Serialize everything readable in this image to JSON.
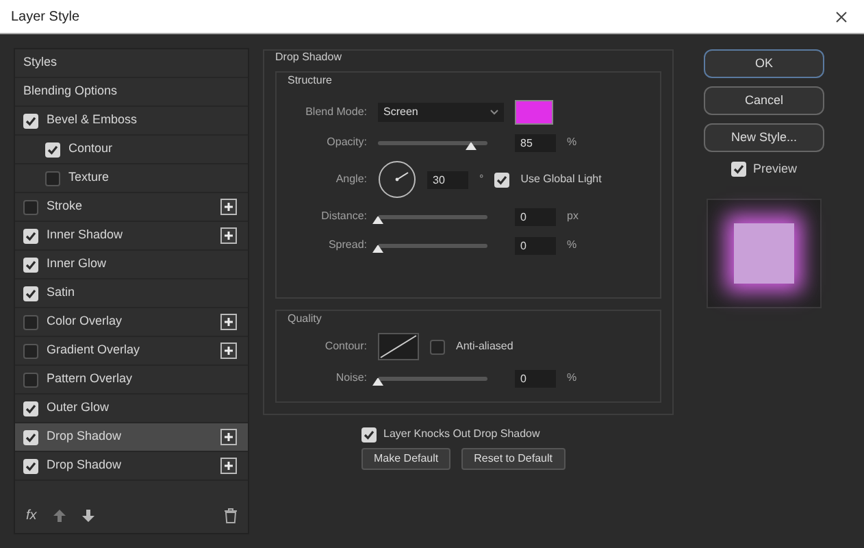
{
  "window": {
    "title": "Layer Style"
  },
  "sidebar": {
    "items": [
      {
        "label": "Styles",
        "kind": "plain",
        "selected": false
      },
      {
        "label": "Blending Options",
        "kind": "plain",
        "selected": false
      },
      {
        "label": "Bevel & Emboss",
        "kind": "check",
        "checked": true,
        "selected": false,
        "add": false,
        "children": [
          {
            "label": "Contour",
            "kind": "check",
            "checked": true,
            "selected": false,
            "add": false
          },
          {
            "label": "Texture",
            "kind": "check",
            "checked": false,
            "selected": false,
            "add": false
          }
        ]
      },
      {
        "label": "Stroke",
        "kind": "check",
        "checked": false,
        "selected": false,
        "add": true
      },
      {
        "label": "Inner Shadow",
        "kind": "check",
        "checked": true,
        "selected": false,
        "add": true
      },
      {
        "label": "Inner Glow",
        "kind": "check",
        "checked": true,
        "selected": false,
        "add": false
      },
      {
        "label": "Satin",
        "kind": "check",
        "checked": true,
        "selected": false,
        "add": false
      },
      {
        "label": "Color Overlay",
        "kind": "check",
        "checked": false,
        "selected": false,
        "add": true
      },
      {
        "label": "Gradient Overlay",
        "kind": "check",
        "checked": false,
        "selected": false,
        "add": true
      },
      {
        "label": "Pattern Overlay",
        "kind": "check",
        "checked": false,
        "selected": false,
        "add": false
      },
      {
        "label": "Outer Glow",
        "kind": "check",
        "checked": true,
        "selected": false,
        "add": false
      },
      {
        "label": "Drop Shadow",
        "kind": "check",
        "checked": true,
        "selected": true,
        "add": true
      },
      {
        "label": "Drop Shadow",
        "kind": "check",
        "checked": true,
        "selected": false,
        "add": true
      }
    ],
    "fx": "fx"
  },
  "panel": {
    "title": "Drop Shadow",
    "structure": {
      "title": "Structure",
      "blend_mode_label": "Blend Mode:",
      "blend_mode": "Screen",
      "color": "#e030e8",
      "opacity": {
        "label": "Opacity:",
        "level": 0.85,
        "value": "85",
        "unit": "%"
      },
      "angle": {
        "label": "Angle:",
        "value": "30",
        "unit": "°",
        "global_light": {
          "label": "Use Global Light",
          "checked": true
        }
      },
      "distance": {
        "label": "Distance:",
        "level": 0,
        "value": "0",
        "unit": "px"
      },
      "spread": {
        "label": "Spread:",
        "level": 0,
        "value": "0",
        "unit": "%"
      }
    },
    "quality": {
      "title": "Quality",
      "contour_label": "Contour:",
      "anti_aliased": {
        "label": "Anti-aliased",
        "checked": false
      },
      "noise": {
        "label": "Noise:",
        "level": 0,
        "value": "0",
        "unit": "%"
      }
    },
    "knockout": {
      "label": "Layer Knocks Out Drop Shadow",
      "checked": true
    },
    "buttons": [
      "Make Default",
      "Reset to Default"
    ]
  },
  "actions": {
    "buttons": [
      {
        "label": "OK",
        "selected": true
      },
      {
        "label": "Cancel",
        "selected": false
      },
      {
        "label": "New Style...",
        "selected": false
      }
    ],
    "preview": {
      "label": "Preview",
      "checked": true
    }
  }
}
